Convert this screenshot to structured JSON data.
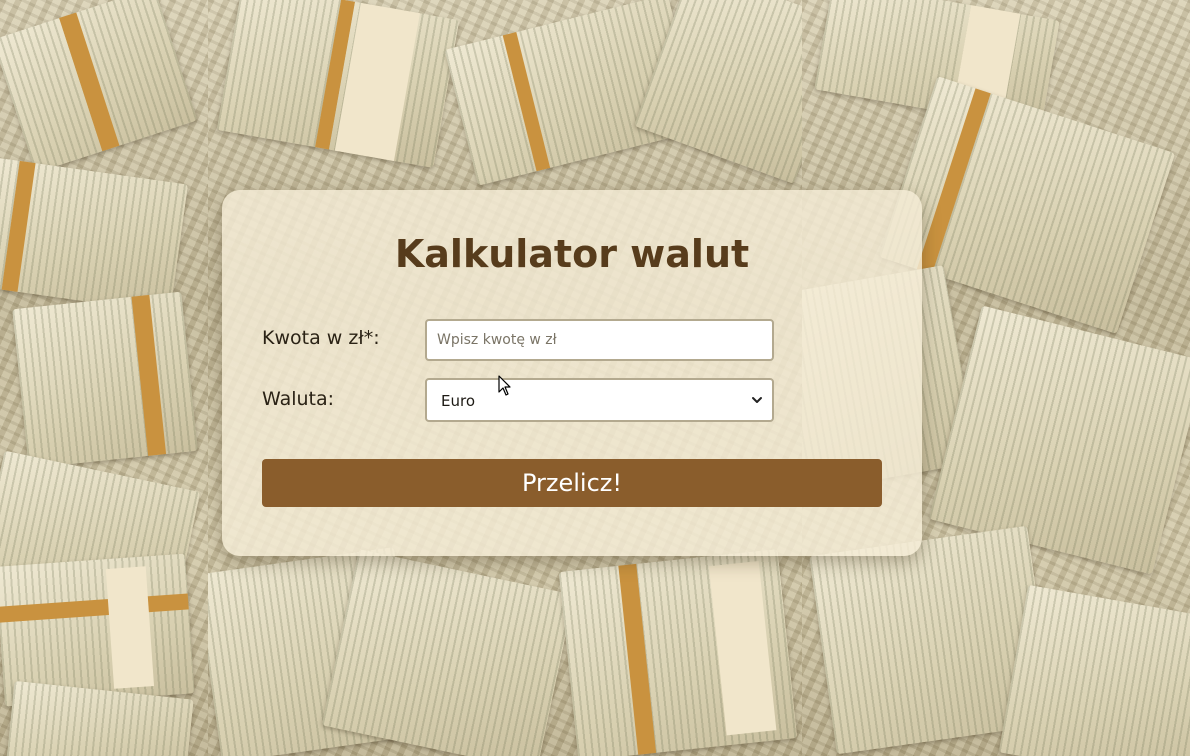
{
  "page": {
    "title": "Kalkulator walut"
  },
  "form": {
    "amount_label": "Kwota w zł*:",
    "amount_placeholder": "Wpisz kwotę w zł",
    "amount_value": "",
    "currency_label": "Waluta:",
    "currency_selected": "Euro",
    "submit_label": "Przelicz!"
  },
  "icons": {
    "select_arrow": "chevron-down-icon",
    "pointer": "mouse-cursor-icon"
  },
  "colors": {
    "title": "#573c1c",
    "button": "#8a5d2c",
    "button_text": "#ffffff",
    "card": "#f4ecd5"
  }
}
